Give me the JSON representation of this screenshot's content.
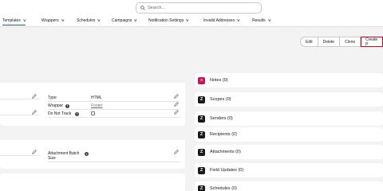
{
  "search": {
    "placeholder": "Search..."
  },
  "nav": {
    "items": [
      {
        "label": "Templates",
        "active": true
      },
      {
        "label": "Wrappers"
      },
      {
        "label": "Schedules"
      },
      {
        "label": "Campaigns"
      },
      {
        "label": "Notification Settings"
      },
      {
        "label": "Invalid Addresses"
      },
      {
        "label": "Results"
      }
    ]
  },
  "actions": {
    "edit": "Edit",
    "delete": "Delete",
    "clone": "Clone",
    "create": "Create P"
  },
  "details": {
    "type_label": "Type",
    "type_value": "HTML",
    "wrapper_label": "Wrapper",
    "wrapper_value": "Footer",
    "do_not_track_label": "Do Not Track",
    "do_not_track_value": false,
    "attachment_batch_size_label": "Attachment Batch Size"
  },
  "related": [
    {
      "icon": "notes-icon",
      "label": "Notes (0)"
    },
    {
      "icon": "z-icon",
      "label": "Scopes (0)"
    },
    {
      "icon": "z-icon",
      "label": "Senders (0)"
    },
    {
      "icon": "z-icon",
      "label": "Recipients (0)"
    },
    {
      "icon": "z-icon",
      "label": "Attachments (0)"
    },
    {
      "icon": "z-icon",
      "label": "Field Updates (0)"
    },
    {
      "icon": "z-icon",
      "label": "Schedules (0)"
    }
  ],
  "colors": {
    "accent": "#1b5f9e",
    "highlight_border": "#d0021b",
    "notes_icon": "#c2185b"
  }
}
